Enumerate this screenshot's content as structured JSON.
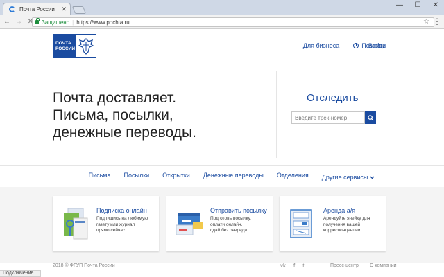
{
  "browser": {
    "tab_title": "Почта России",
    "tab_close": "✕",
    "omnibox": {
      "secure_label": "Защищено",
      "separator": "|",
      "url": "https://www.pochta.ru"
    },
    "nav": {
      "back": "←",
      "forward": "→",
      "stop": "✕"
    },
    "window_buttons": {
      "minimize": "—",
      "maximize": "☐",
      "close": "✕"
    },
    "star": "☆",
    "menu": "⋮",
    "status": "Подключение..."
  },
  "header": {
    "logo_text_line1": "ПОЧТА",
    "logo_text_line2": "РОССИИ",
    "links": {
      "business": "Для бизнеса",
      "help": "Помощь",
      "login": "Войти"
    }
  },
  "hero": {
    "line1": "Почта доставляет.",
    "line2": "Письма, посылки,",
    "line3": "денежные переводы.",
    "track_title": "Отследить",
    "track_placeholder": "Введите трек-номер"
  },
  "services": [
    "Письма",
    "Посылки",
    "Открытки",
    "Денежные переводы",
    "Отделения",
    "Другие сервисы"
  ],
  "cards": [
    {
      "title": "Подписка онлайн",
      "desc": [
        "Подпишись на любимую",
        "газету или журнал",
        "прямо сейчас"
      ]
    },
    {
      "title": "Отправить посылку",
      "desc": [
        "Подготовь посылку,",
        "оплати онлайн,",
        "сдай без очереди"
      ]
    },
    {
      "title": "Аренда а/я",
      "desc": [
        "Арендуйте ячейку для",
        "получения вашей",
        "корреспонденции"
      ]
    }
  ],
  "footer": {
    "copyright": "2018 © ФГУП Почта России",
    "social": [
      "vk",
      "f",
      "t"
    ],
    "links": [
      "Пресс-центр",
      "О компании"
    ]
  },
  "colors": {
    "brand": "#1a4ba0",
    "secure": "#1e8e3e"
  }
}
